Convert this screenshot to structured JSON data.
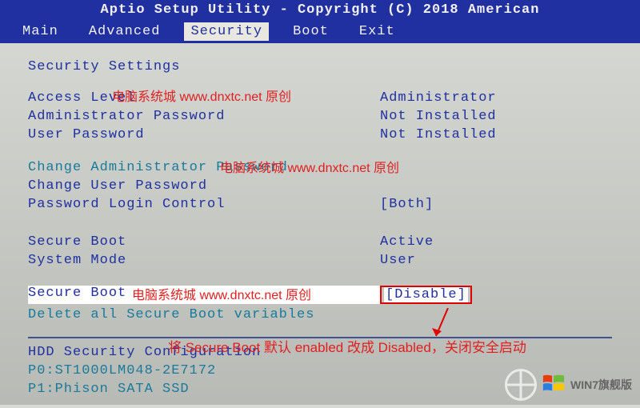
{
  "header": {
    "title": "Aptio Setup Utility - Copyright (C) 2018 American"
  },
  "menu": {
    "items": [
      "Main",
      "Advanced",
      "Security",
      "Boot",
      "Exit"
    ],
    "active": "Security"
  },
  "section_title": "Security Settings",
  "info": {
    "access_level": {
      "label": "Access Level",
      "value": "Administrator"
    },
    "admin_pw": {
      "label": "Administrator Password",
      "value": "Not Installed"
    },
    "user_pw": {
      "label": "User Password",
      "value": "Not Installed"
    }
  },
  "actions": {
    "change_admin": "Change Administrator Password",
    "change_user": "Change User Password",
    "pw_login_ctrl": {
      "label": "Password Login Control",
      "value": "[Both]"
    }
  },
  "secure": {
    "boot_status": {
      "label": "Secure Boot",
      "value": "Active"
    },
    "system_mode": {
      "label": "System Mode",
      "value": "User"
    },
    "secure_boot": {
      "label": "Secure Boot",
      "value": "[Disable]"
    },
    "delete_vars": "Delete all Secure Boot variables"
  },
  "hdd": {
    "title": "HDD Security Configuration",
    "drive0": "P0:ST1000LM048-2E7172",
    "drive1": "P1:Phison SATA SSD"
  },
  "watermarks": {
    "wm1": "电脑系统城 www.dnxtc.net 原创",
    "wm2": "电脑系统城 www.dnxtc.net 原创",
    "wm3": "电脑系统城 www.dnxtc.net 原创"
  },
  "annotation": "将 Secure Boot 默认 enabled 改成 Disabled，关闭安全启动",
  "logo_text": "WIN7旗舰版"
}
